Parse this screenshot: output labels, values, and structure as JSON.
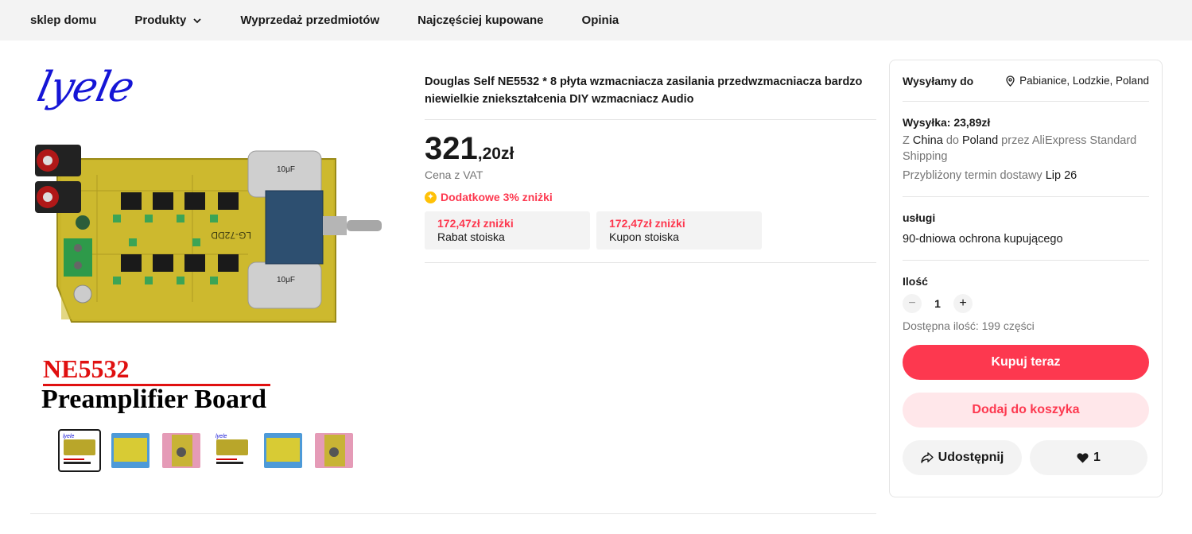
{
  "nav": {
    "items": [
      {
        "label": "sklep domu"
      },
      {
        "label": "Produkty",
        "has_dropdown": true
      },
      {
        "label": "Wyprzedaż przedmiotów"
      },
      {
        "label": "Najczęściej kupowane"
      },
      {
        "label": "Opinia"
      }
    ]
  },
  "gallery": {
    "logo_text": "lyele",
    "caption_line1": "NE5532",
    "caption_line2": "Preamplifier Board",
    "board_labels": {
      "cap_top": "10μF",
      "cap_bottom": "10μF",
      "pcb_code": "LG-72DD"
    },
    "thumbnails": [
      {
        "style": "board",
        "active": true
      },
      {
        "style": "blue",
        "active": false
      },
      {
        "style": "pink",
        "active": false
      },
      {
        "style": "board",
        "active": false
      },
      {
        "style": "blue",
        "active": false
      },
      {
        "style": "pink",
        "active": false
      }
    ]
  },
  "product": {
    "title": "Douglas Self NE5532 * 8 płyta wzmacniacza zasilania przedwzmacniacza bardzo niewielkie zniekształcenia DIY wzmacniacz Audio",
    "price_main": "321",
    "price_frac": ",20zł",
    "vat_note": "Cena z VAT",
    "extra_discount": "Dodatkowe 3% zniżki",
    "coupons": [
      {
        "amount": "172,47zł zniżki",
        "label": "Rabat stoiska"
      },
      {
        "amount": "172,47zł zniżki",
        "label": "Kupon stoiska"
      }
    ]
  },
  "panel": {
    "ship_to_label": "Wysyłamy do",
    "ship_to_location": "Pabianice, Lodzkie, Poland",
    "shipping_title": "Wysyłka: 23,89zł",
    "shipping_from_prefix": "Z",
    "shipping_from": "China",
    "shipping_to_prefix": "do",
    "shipping_to": "Poland",
    "shipping_via_prefix": "przez",
    "shipping_method": "AliExpress Standard Shipping",
    "delivery_label": "Przybliżony termin dostawy",
    "delivery_date": "Lip 26",
    "services_title": "usługi",
    "services_text": "90-dniowa ochrona kupującego",
    "qty_title": "Ilość",
    "qty_value": "1",
    "availability": "Dostępna ilość: 199 części",
    "buy_label": "Kupuj teraz",
    "cart_label": "Dodaj do koszyka",
    "share_label": "Udostępnij",
    "like_count": "1"
  },
  "colors": {
    "accent": "#fd384f",
    "accent_soft": "#ffe7ea",
    "nav_bg": "#f3f3f3",
    "muted": "#757575",
    "coin": "#ffc107"
  }
}
